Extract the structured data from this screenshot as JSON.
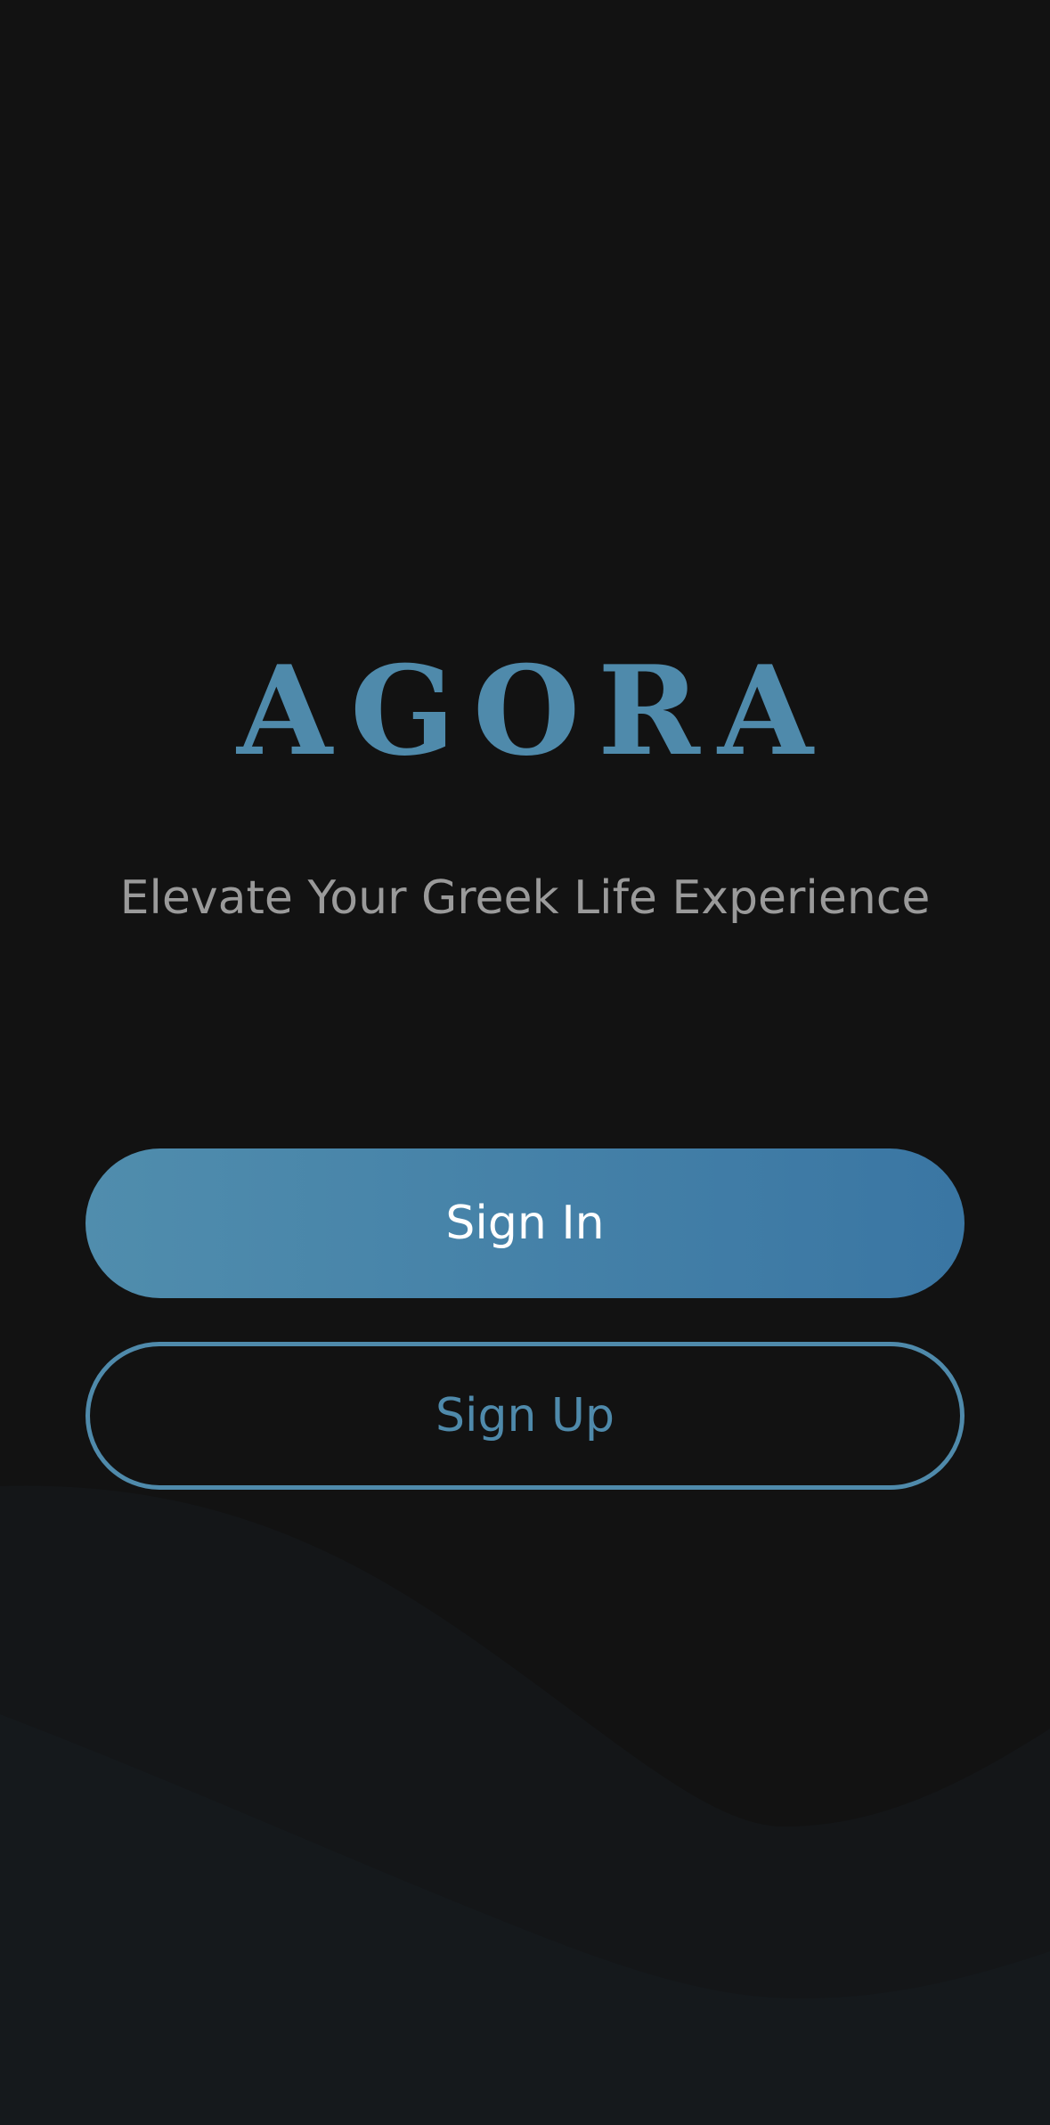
{
  "app": {
    "logo_text": "AGORA",
    "tagline": "Elevate Your Greek Life Experience"
  },
  "actions": {
    "sign_in_label": "Sign In",
    "sign_up_label": "Sign Up"
  },
  "colors": {
    "background": "#121212",
    "accent": "#4f8aab",
    "accent_dark": "#3a76a3",
    "tagline": "#9a9a9a",
    "wave": "#161a1c"
  }
}
